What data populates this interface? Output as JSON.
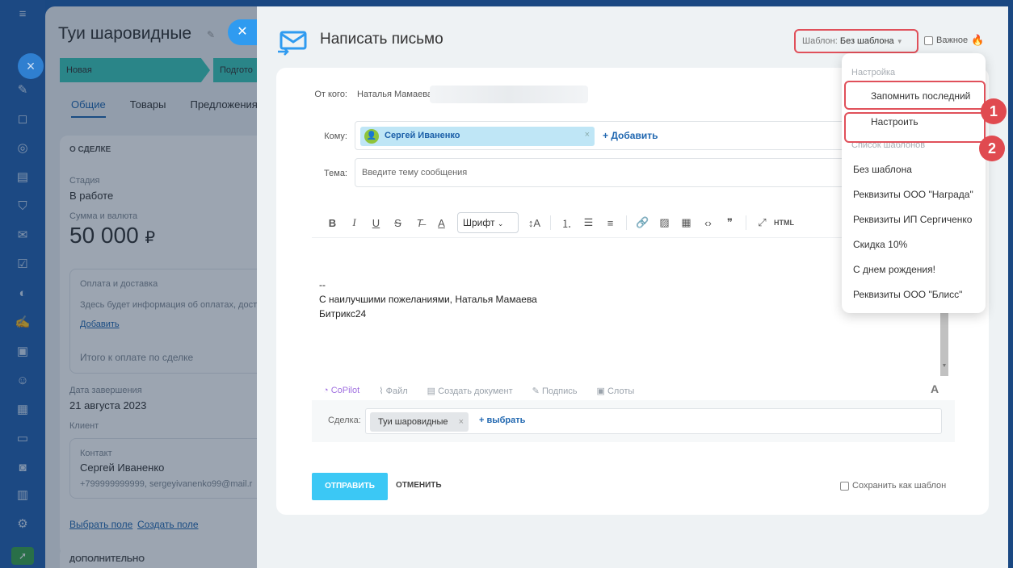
{
  "deal": {
    "title": "Туи шаровидные",
    "stages": [
      "Новая",
      "Подгото"
    ],
    "tabs": [
      "Общие",
      "Товары",
      "Предложения"
    ],
    "section_about": "О СДЕЛКЕ",
    "stage_label": "Стадия",
    "stage_value": "В работе",
    "amount_label": "Сумма и валюта",
    "amount_value": "50 000",
    "currency": "₽",
    "pay_label": "Оплата и доставка",
    "pay_info": "Здесь будет информация об оплатах, дост",
    "pay_add": "Добавить",
    "total_label": "Итого к оплате по сделке",
    "close_date_label": "Дата завершения",
    "close_date_value": "21 августа 2023",
    "client_label": "Клиент",
    "contact_label": "Контакт",
    "contact_name": "Сергей Иваненко",
    "contact_info": "+799999999999, sergeyivanenko99@mail.r",
    "choose_field": "Выбрать поле",
    "create_field": "Создать поле",
    "section_extra": "ДОПОЛНИТЕЛЬНО"
  },
  "mail": {
    "title": "Написать письмо",
    "template_label": "Шаблон:",
    "template_value": "Без шаблона",
    "important_label": "Важное",
    "from_label": "От кого:",
    "from_value": "Наталья Мамаева",
    "to_label": "Кому:",
    "recipient": "Сергей Иваненко",
    "add_recipient": "+ Добавить",
    "subject_label": "Тема:",
    "subject_placeholder": "Введите тему сообщения",
    "font_select": "Шрифт",
    "toolbar_icons": [
      "bold-icon",
      "italic-icon",
      "underline-icon",
      "strikethrough-icon",
      "clear-format-icon",
      "text-color-icon",
      "font-size-icon",
      "numbered-list-icon",
      "bulleted-list-icon",
      "align-icon",
      "link-icon",
      "image-icon",
      "table-icon",
      "code-icon",
      "quote-icon",
      "fullscreen-icon",
      "html-icon"
    ],
    "toolbar_html": "HTML",
    "body_lines": [
      "--",
      "С наилучшими пожеланиями, Наталья Мамаева",
      "Битрикс24"
    ],
    "attach": {
      "copilot": "CoPilot",
      "file": "Файл",
      "create_doc": "Создать документ",
      "signature": "Подпись",
      "slots": "Слоты"
    },
    "deal_label": "Сделка:",
    "deal_chip": "Туи шаровидные",
    "deal_pick": "+ выбрать",
    "send": "ОТПРАВИТЬ",
    "cancel": "ОТМЕНИТЬ",
    "save_template": "Сохранить как шаблон"
  },
  "dropdown": {
    "section_settings": "Настройка",
    "remember_last": "Запомнить последний",
    "configure": "Настроить",
    "section_list": "Список шаблонов",
    "templates": [
      "Без шаблона",
      "Реквизиты ООО \"Награда\"",
      "Реквизиты ИП Сергиченко",
      "Скидка 10%",
      "С днем рождения!",
      "Реквизиты ООО \"Блисс\""
    ]
  },
  "badges": [
    "1",
    "2"
  ],
  "colors": {
    "accent": "#3bc8f5",
    "highlight": "#e0505a",
    "link": "#2067b0",
    "stage": "#3bc8b8"
  }
}
